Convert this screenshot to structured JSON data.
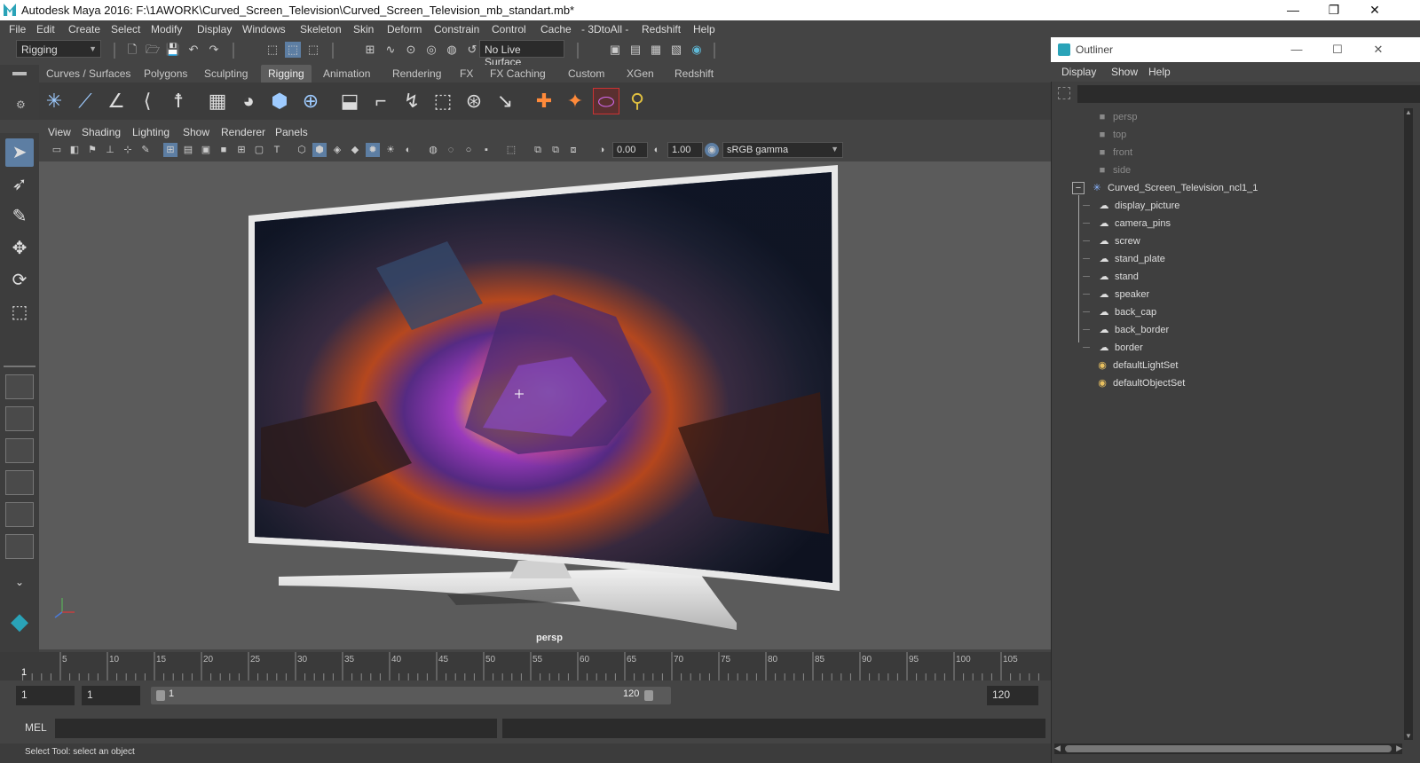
{
  "window": {
    "title": "Autodesk Maya 2016: F:\\1AWORK\\Curved_Screen_Television\\Curved_Screen_Television_mb_standart.mb*",
    "controls": [
      "—",
      "❐",
      "✕"
    ]
  },
  "menubar": [
    "File",
    "Edit",
    "Create",
    "Select",
    "Modify",
    "Display",
    "Windows",
    "Skeleton",
    "Skin",
    "Deform",
    "Constrain",
    "Control",
    "Cache",
    "- 3DtoAll -",
    "Redshift",
    "Help"
  ],
  "statusline": {
    "mode": "Rigging",
    "live_surface": "No Live Surface"
  },
  "shelf": {
    "tabs": [
      "Curves / Surfaces",
      "Polygons",
      "Sculpting",
      "Rigging",
      "Animation",
      "Rendering",
      "FX",
      "FX Caching",
      "Custom",
      "XGen",
      "Redshift"
    ],
    "active_tab": "Rigging"
  },
  "viewport": {
    "menu": [
      "View",
      "Shading",
      "Lighting",
      "Show",
      "Renderer",
      "Panels"
    ],
    "exposure": "0.00",
    "gamma": "1.00",
    "color_space": "sRGB gamma",
    "camera_label": "persp"
  },
  "timeline": {
    "ticks": [
      "5",
      "10",
      "15",
      "20",
      "25",
      "30",
      "35",
      "40",
      "45",
      "50",
      "55",
      "60",
      "65",
      "70",
      "75",
      "80",
      "85",
      "90",
      "95",
      "100",
      "105"
    ],
    "current_frame": "1",
    "start_field": "1",
    "playback_start": "1",
    "range_start": "1",
    "range_end": "120",
    "end_field": "120"
  },
  "commandline": {
    "label": "MEL"
  },
  "helpline": "Select Tool: select an object",
  "outliner": {
    "title": "Outliner",
    "controls": [
      "—",
      "☐",
      "✕"
    ],
    "menu": [
      "Display",
      "Show",
      "Help"
    ],
    "cameras": [
      "persp",
      "top",
      "front",
      "side"
    ],
    "group": "Curved_Screen_Television_ncl1_1",
    "children": [
      "display_picture",
      "camera_pins",
      "screw",
      "stand_plate",
      "stand",
      "speaker",
      "back_cap",
      "back_border",
      "border"
    ],
    "sets": [
      "defaultLightSet",
      "defaultObjectSet"
    ]
  },
  "colors": {
    "accent": "#5d7ea3",
    "maya_teal": "#2aa3b8"
  }
}
